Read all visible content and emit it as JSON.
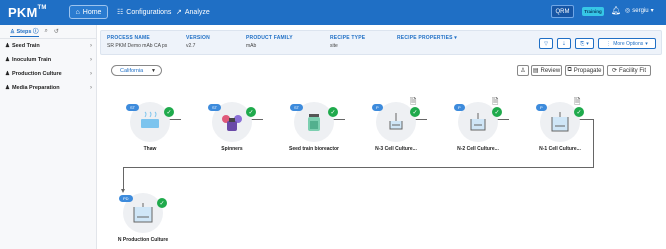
{
  "app": {
    "logo": "PKM",
    "logo_mark": "TM"
  },
  "nav": {
    "home": "Home",
    "configurations": "Configurations",
    "analyze": "Analyze",
    "qrm": "QRM",
    "training": "Training",
    "user": "sergiu"
  },
  "sidebar": {
    "tab_label": "Steps",
    "items": [
      {
        "label": "Seed Train"
      },
      {
        "label": "Inoculum Train"
      },
      {
        "label": "Production Culture"
      },
      {
        "label": "Media Preparation"
      }
    ]
  },
  "process": {
    "name_label": "PROCESS NAME",
    "name_value": "SR PKM Demo mAb CA ps",
    "version_label": "VERSION",
    "version_value": "v2.7",
    "family_label": "PRODUCT FAMILY",
    "family_value": "mAb",
    "recipe_type_label": "RECIPE TYPE",
    "recipe_type_value": "site",
    "recipe_props_label": "RECIPE PROPERTIES",
    "more_options": "More Options"
  },
  "toolbar": {
    "location": "California",
    "review": "Review",
    "propagate": "Propagate",
    "facility_fit": "Facility Fit"
  },
  "nodes": [
    {
      "badge": "ST",
      "name": "Thaw",
      "has_check": true,
      "has_doc": false
    },
    {
      "badge": "ST",
      "name": "Spinners",
      "has_check": true,
      "has_doc": false
    },
    {
      "badge": "ST",
      "name": "Seed train bioreactor",
      "has_check": true,
      "has_doc": false
    },
    {
      "badge": "P",
      "name": "N-3 Cell Culture...",
      "has_check": true,
      "has_doc": true
    },
    {
      "badge": "P",
      "name": "N-2 Cell Culture...",
      "has_check": true,
      "has_doc": true
    },
    {
      "badge": "P",
      "name": "N-1 Cell Culture...",
      "has_check": true,
      "has_doc": true
    },
    {
      "badge": "PD",
      "name": "N Production Culture",
      "has_check": true,
      "has_doc": false
    }
  ],
  "colors": {
    "brand": "#1f6fc5",
    "check": "#1faa4c",
    "badge": "#3d8bdc"
  }
}
